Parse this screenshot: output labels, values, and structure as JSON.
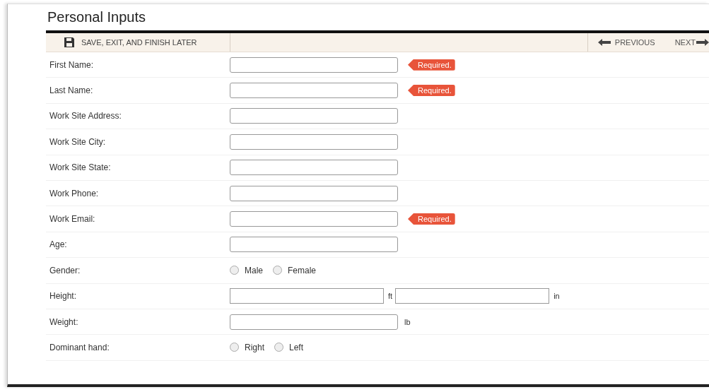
{
  "title": "Personal Inputs",
  "toolbar": {
    "save": "SAVE, EXIT, AND FINISH LATER",
    "previous": "PREVIOUS",
    "next": "NEXT"
  },
  "rows": [
    {
      "kind": "text",
      "label": "First Name:",
      "required": true,
      "tag": "Required."
    },
    {
      "kind": "text",
      "label": "Last Name:",
      "required": true,
      "tag": "Required."
    },
    {
      "kind": "text",
      "label": "Work Site Address:",
      "required": false
    },
    {
      "kind": "text",
      "label": "Work Site City:",
      "required": false
    },
    {
      "kind": "text",
      "label": "Work Site State:",
      "required": false
    },
    {
      "kind": "text",
      "label": "Work Phone:",
      "required": false
    },
    {
      "kind": "text",
      "label": "Work Email:",
      "required": true,
      "tag": "Required."
    },
    {
      "kind": "text",
      "label": "Age:",
      "required": false
    },
    {
      "kind": "radio",
      "label": "Gender:",
      "options": [
        {
          "label": "Male",
          "selected": false
        },
        {
          "label": "Female",
          "selected": false
        }
      ]
    },
    {
      "kind": "split",
      "label": "Height:",
      "units": [
        "ft",
        "in"
      ]
    },
    {
      "kind": "unit",
      "label": "Weight:",
      "unit": "lb"
    },
    {
      "kind": "radio",
      "label": "Dominant hand:",
      "options": [
        {
          "label": "Right",
          "selected": false
        },
        {
          "label": "Left",
          "selected": false
        }
      ]
    }
  ]
}
